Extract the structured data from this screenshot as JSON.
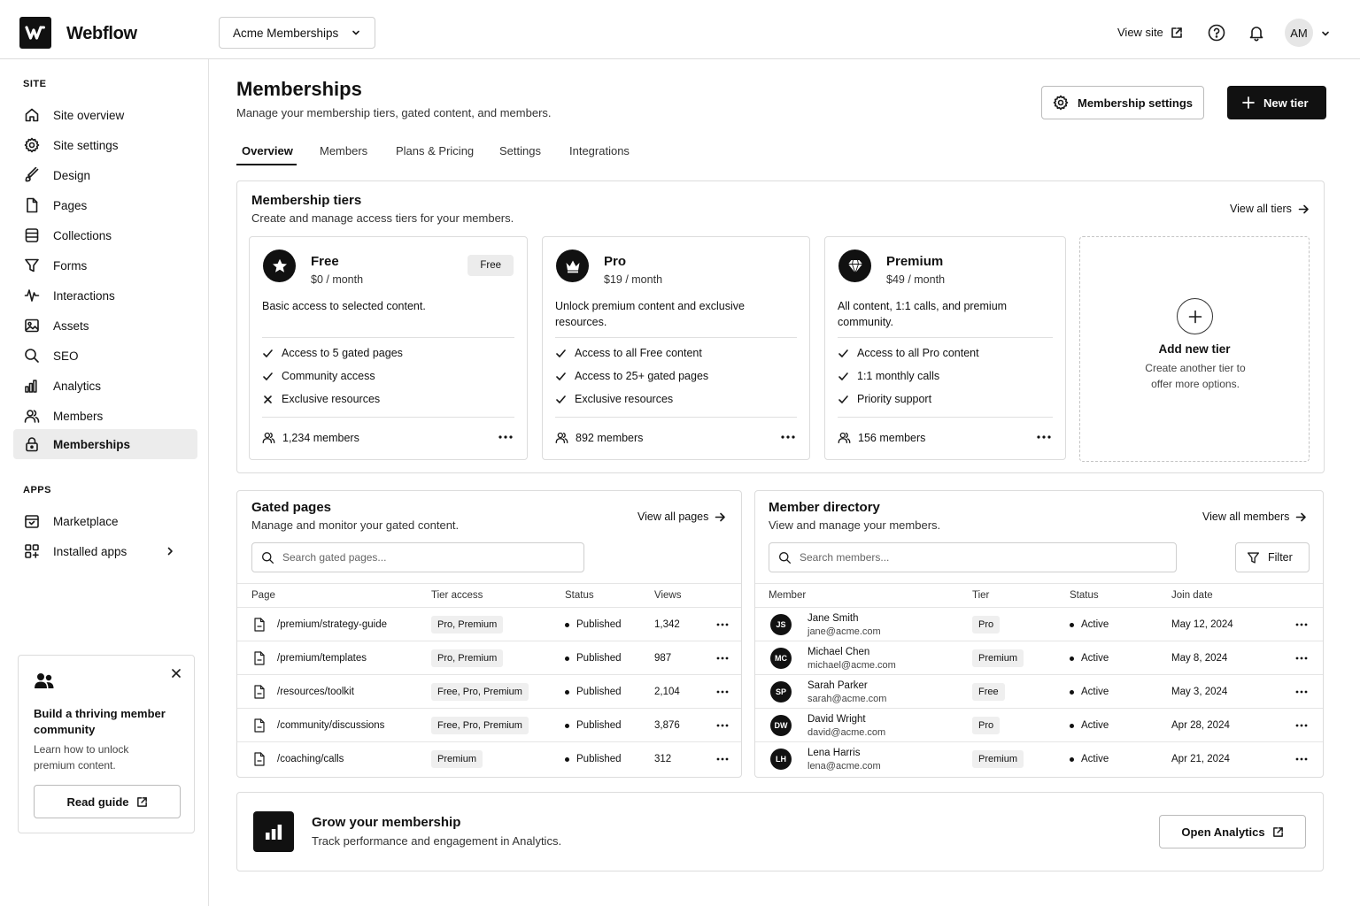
{
  "topbar": {
    "brand": "Webflow",
    "site_selector": "Acme Memberships",
    "view_site": "View site",
    "avatar_initials": "AM"
  },
  "sidebar": {
    "site_section": "SITE",
    "site_items": [
      {
        "label": "Site overview",
        "icon": "home-icon"
      },
      {
        "label": "Site settings",
        "icon": "gear-icon"
      },
      {
        "label": "Design",
        "icon": "brush-icon"
      },
      {
        "label": "Pages",
        "icon": "page-icon"
      },
      {
        "label": "Collections",
        "icon": "database-icon"
      },
      {
        "label": "Forms",
        "icon": "forms-icon"
      },
      {
        "label": "Interactions",
        "icon": "interactions-icon"
      },
      {
        "label": "Assets",
        "icon": "image-icon"
      },
      {
        "label": "SEO",
        "icon": "search-icon"
      },
      {
        "label": "Analytics",
        "icon": "bar-chart-icon"
      },
      {
        "label": "Members",
        "icon": "users-icon"
      },
      {
        "label": "Memberships",
        "icon": "lock-icon"
      }
    ],
    "apps_section": "APPS",
    "app_items": [
      {
        "label": "Marketplace",
        "icon": "store-icon"
      },
      {
        "label": "Installed apps",
        "icon": "apps-grid-icon"
      }
    ],
    "promo": {
      "title": "Build a thriving member community",
      "text": "Learn how to unlock premium content.",
      "button": "Read guide"
    }
  },
  "header": {
    "title": "Memberships",
    "subtitle": "Manage your membership tiers, gated content, and members.",
    "settings_button": "Membership settings",
    "new_tier_button": "New tier"
  },
  "tabs": [
    "Overview",
    "Members",
    "Plans & Pricing",
    "Settings",
    "Integrations"
  ],
  "tiers_panel": {
    "title": "Membership tiers",
    "subtitle": "Create and manage access tiers for your members.",
    "view_all": "View all tiers",
    "tiers": [
      {
        "name": "Free",
        "price": "$0 / month",
        "badge": "Free",
        "description": "Basic access to selected content.",
        "features": [
          {
            "text": "Access to 5 gated pages",
            "included": true
          },
          {
            "text": "Community access",
            "included": true
          },
          {
            "text": "Exclusive resources",
            "included": false
          }
        ],
        "members": "1,234 members",
        "icon": "star-icon"
      },
      {
        "name": "Pro",
        "price": "$19 / month",
        "badge": "",
        "description": "Unlock premium content and exclusive resources.",
        "features": [
          {
            "text": "Access to all Free content",
            "included": true
          },
          {
            "text": "Access to 25+ gated pages",
            "included": true
          },
          {
            "text": "Exclusive resources",
            "included": true
          }
        ],
        "members": "892 members",
        "icon": "crown-icon"
      },
      {
        "name": "Premium",
        "price": "$49 / month",
        "badge": "",
        "description": "All content, 1:1 calls, and premium community.",
        "features": [
          {
            "text": "Access to all Pro content",
            "included": true
          },
          {
            "text": "1:1 monthly calls",
            "included": true
          },
          {
            "text": "Priority support",
            "included": true
          }
        ],
        "members": "156 members",
        "icon": "diamond-icon"
      }
    ],
    "add_tier": {
      "title": "Add new tier",
      "text": "Create another tier to offer more options."
    }
  },
  "gated_pages": {
    "title": "Gated pages",
    "subtitle": "Manage and monitor your gated content.",
    "view_all": "View all pages",
    "search_placeholder": "Search gated pages...",
    "columns": [
      "Page",
      "Tier access",
      "Status",
      "Views"
    ],
    "rows": [
      {
        "page": "/premium/strategy-guide",
        "tier": "Pro, Premium",
        "status": "Published",
        "views": "1,342"
      },
      {
        "page": "/premium/templates",
        "tier": "Pro, Premium",
        "status": "Published",
        "views": "987"
      },
      {
        "page": "/resources/toolkit",
        "tier": "Free, Pro, Premium",
        "status": "Published",
        "views": "2,104"
      },
      {
        "page": "/community/discussions",
        "tier": "Free, Pro, Premium",
        "status": "Published",
        "views": "3,876"
      },
      {
        "page": "/coaching/calls",
        "tier": "Premium",
        "status": "Published",
        "views": "312"
      }
    ]
  },
  "member_directory": {
    "title": "Member directory",
    "subtitle": "View and manage your members.",
    "view_all": "View all members",
    "search_placeholder": "Search members...",
    "filter_button": "Filter",
    "columns": [
      "Member",
      "Tier",
      "Status",
      "Join date"
    ],
    "rows": [
      {
        "initials": "JS",
        "name": "Jane Smith",
        "email": "jane@acme.com",
        "tier": "Pro",
        "status": "Active",
        "joined": "May 12, 2024"
      },
      {
        "initials": "MC",
        "name": "Michael Chen",
        "email": "michael@acme.com",
        "tier": "Premium",
        "status": "Active",
        "joined": "May 8, 2024"
      },
      {
        "initials": "SP",
        "name": "Sarah Parker",
        "email": "sarah@acme.com",
        "tier": "Free",
        "status": "Active",
        "joined": "May 3, 2024"
      },
      {
        "initials": "DW",
        "name": "David Wright",
        "email": "david@acme.com",
        "tier": "Pro",
        "status": "Active",
        "joined": "Apr 28, 2024"
      },
      {
        "initials": "LH",
        "name": "Lena Harris",
        "email": "lena@acme.com",
        "tier": "Premium",
        "status": "Active",
        "joined": "Apr 21, 2024"
      }
    ]
  },
  "grow_banner": {
    "title": "Grow your membership",
    "text": "Track performance and engagement in Analytics.",
    "button": "Open Analytics"
  }
}
